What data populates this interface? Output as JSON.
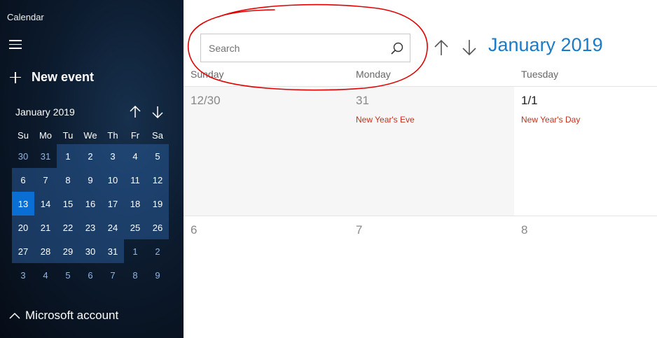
{
  "app": {
    "title": "Calendar"
  },
  "sidebar": {
    "new_event_label": "New event",
    "mini_calendar": {
      "month_label": "January 2019",
      "days_of_week": [
        "Su",
        "Mo",
        "Tu",
        "We",
        "Th",
        "Fr",
        "Sa"
      ],
      "weeks": [
        [
          "30",
          "31",
          "1",
          "2",
          "3",
          "4",
          "5"
        ],
        [
          "6",
          "7",
          "8",
          "9",
          "10",
          "11",
          "12"
        ],
        [
          "13",
          "14",
          "15",
          "16",
          "17",
          "18",
          "19"
        ],
        [
          "20",
          "21",
          "22",
          "23",
          "24",
          "25",
          "26"
        ],
        [
          "27",
          "28",
          "29",
          "30",
          "31",
          "1",
          "2"
        ],
        [
          "3",
          "4",
          "5",
          "6",
          "7",
          "8",
          "9"
        ]
      ],
      "today": "13"
    },
    "account_label": "Microsoft account"
  },
  "main": {
    "search": {
      "placeholder": "Search",
      "value": ""
    },
    "month_title": "January 2019",
    "day_headers": [
      "Sunday",
      "Monday",
      "Tuesday"
    ],
    "weeks": [
      [
        {
          "day": "12/30",
          "event": ""
        },
        {
          "day": "31",
          "event": "New Year's Eve"
        },
        {
          "day": "1/1",
          "event": "New Year's Day"
        }
      ],
      [
        {
          "day": "6",
          "event": ""
        },
        {
          "day": "7",
          "event": ""
        },
        {
          "day": "8",
          "event": ""
        }
      ]
    ]
  },
  "icons": [
    "hamburger-icon",
    "plus-icon",
    "arrow-up-icon",
    "arrow-down-icon",
    "search-icon",
    "chevron-up-icon"
  ],
  "colors": {
    "accent": "#1a7bc8",
    "event_text": "#c0321d",
    "today_highlight": "#0a6fd4",
    "annotation_circle": "#e00000"
  }
}
